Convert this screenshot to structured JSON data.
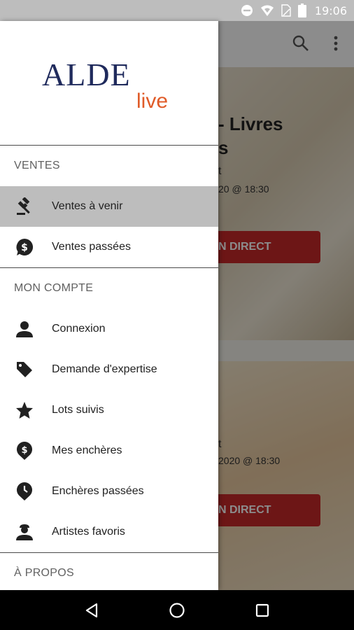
{
  "status_bar": {
    "time": "19:06",
    "icons": [
      "dnd-icon",
      "wifi-icon",
      "sim-icon",
      "battery-icon"
    ]
  },
  "background": {
    "cards": [
      {
        "title_line1": "- Livres",
        "title_line2": "s",
        "subtitle": "t",
        "date": "20 @ 18:30",
        "button": "N DIRECT"
      },
      {
        "subtitle": "t",
        "date": "2020 @ 18:30",
        "button": "N DIRECT"
      }
    ]
  },
  "drawer": {
    "logo": {
      "brand": "ALDE",
      "sub": "live"
    },
    "sections": {
      "ventes": "VENTES",
      "mon_compte": "MON COMPTE",
      "a_propos": "À PROPOS"
    },
    "items": [
      {
        "label": "Ventes à venir",
        "icon": "gavel-icon"
      },
      {
        "label": "Ventes passées",
        "icon": "dollar-bubble-icon"
      },
      {
        "label": "Connexion",
        "icon": "person-icon"
      },
      {
        "label": "Demande d'expertise",
        "icon": "tag-icon"
      },
      {
        "label": "Lots suivis",
        "icon": "star-icon"
      },
      {
        "label": "Mes enchères",
        "icon": "dollar-pin-icon"
      },
      {
        "label": "Enchères passées",
        "icon": "clock-pin-icon"
      },
      {
        "label": "Artistes favoris",
        "icon": "artist-icon"
      }
    ]
  },
  "nav_bar": {
    "buttons": [
      "back-icon",
      "home-icon",
      "recents-icon"
    ]
  },
  "colors": {
    "accent": "#e05b28",
    "brand": "#1f2a5c",
    "button_red": "#c62828",
    "active_bg": "#bdbdbd"
  }
}
